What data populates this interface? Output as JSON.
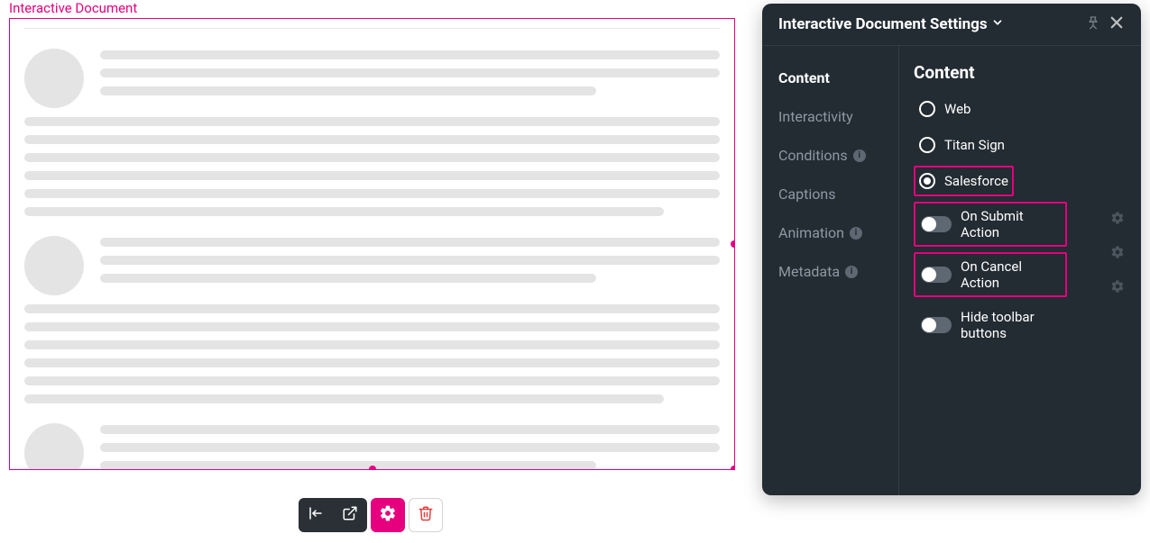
{
  "component": {
    "label": "Interactive Document"
  },
  "toolbar": {
    "align_title": "Align",
    "open_title": "Open",
    "settings_title": "Settings",
    "delete_title": "Delete"
  },
  "panel": {
    "title": "Interactive Document Settings",
    "sidebar": [
      {
        "label": "Content",
        "has_badge": false,
        "active": true
      },
      {
        "label": "Interactivity",
        "has_badge": false,
        "active": false
      },
      {
        "label": "Conditions",
        "has_badge": true,
        "active": false
      },
      {
        "label": "Captions",
        "has_badge": false,
        "active": false
      },
      {
        "label": "Animation",
        "has_badge": true,
        "active": false
      },
      {
        "label": "Metadata",
        "has_badge": true,
        "active": false
      }
    ],
    "content": {
      "heading": "Content",
      "radios": [
        {
          "label": "Web",
          "selected": false,
          "highlight": false
        },
        {
          "label": "Titan Sign",
          "selected": false,
          "highlight": false
        },
        {
          "label": "Salesforce",
          "selected": true,
          "highlight": true
        }
      ],
      "toggles": [
        {
          "label": "On Submit Action",
          "on": false,
          "highlight": true,
          "has_gear": true
        },
        {
          "label": "On Cancel Action",
          "on": false,
          "highlight": true,
          "has_gear": true
        },
        {
          "label": "Hide toolbar buttons",
          "on": false,
          "highlight": false,
          "has_gear": true
        }
      ]
    }
  }
}
